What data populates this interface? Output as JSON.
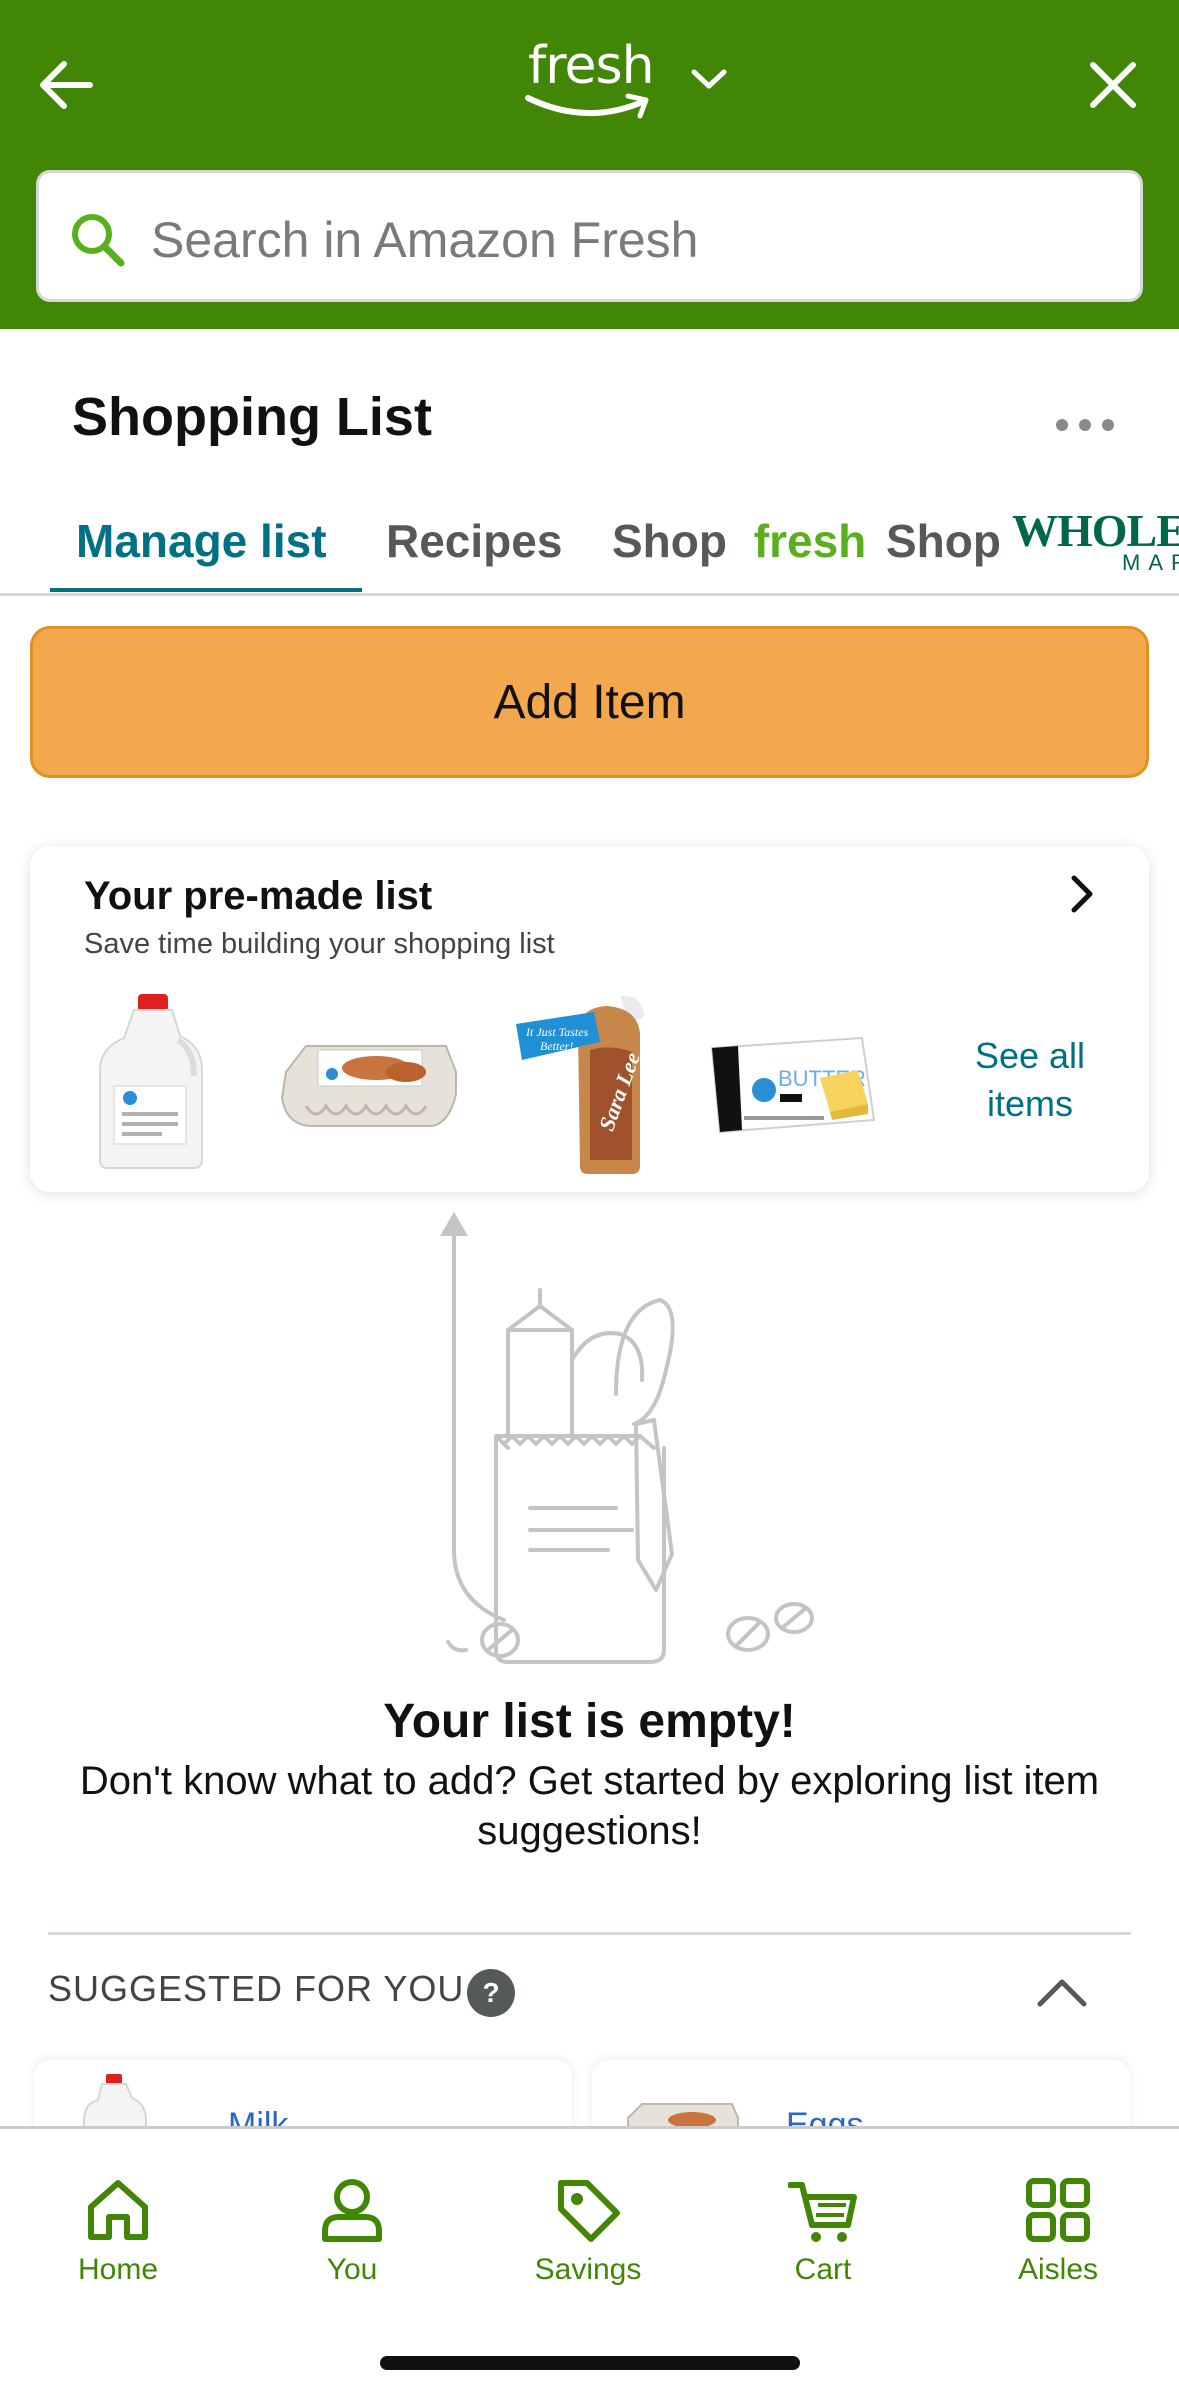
{
  "header": {
    "logo_text": "fresh",
    "search_placeholder": "Search in Amazon Fresh",
    "icons": [
      "back-arrow-icon",
      "chevron-down-icon",
      "close-icon",
      "search-icon"
    ],
    "bg_color": "#418605"
  },
  "page": {
    "title": "Shopping List"
  },
  "tabs": [
    {
      "label": "Manage list",
      "active": true
    },
    {
      "label": "Recipes",
      "active": false
    },
    {
      "label": "Shop",
      "brand": "fresh",
      "active": false
    },
    {
      "label": "Shop",
      "brand_logo_top": "WHOLE FC",
      "brand_logo_bottom": "MARKET",
      "active": false
    }
  ],
  "add_item": {
    "label": "Add Item",
    "color": "#f3a84e"
  },
  "premade": {
    "title": "Your pre-made list",
    "subtitle": "Save time building your shopping list",
    "see_all": "See all items",
    "products": [
      {
        "name": "milk-gallon-image"
      },
      {
        "name": "eggs-carton-image"
      },
      {
        "name": "bread-loaf-image",
        "badge": "It Just Tastes Better!",
        "brand": "Sara Lee"
      },
      {
        "name": "butter-box-image",
        "label": "BUTTER"
      }
    ]
  },
  "empty_state": {
    "title": "Your list is empty!",
    "description": "Don't know what to add? Get started by exploring list item suggestions!"
  },
  "suggested": {
    "title": "SUGGESTED FOR YOU",
    "items": [
      {
        "name": "Milk"
      },
      {
        "name": "Eggs"
      }
    ]
  },
  "bottom_nav": [
    {
      "label": "Home",
      "icon": "home-icon"
    },
    {
      "label": "You",
      "icon": "person-icon"
    },
    {
      "label": "Savings",
      "icon": "tag-icon"
    },
    {
      "label": "Cart",
      "icon": "cart-icon"
    },
    {
      "label": "Aisles",
      "icon": "grid-icon"
    }
  ],
  "accent_color": "#007185",
  "nav_color": "#418605"
}
